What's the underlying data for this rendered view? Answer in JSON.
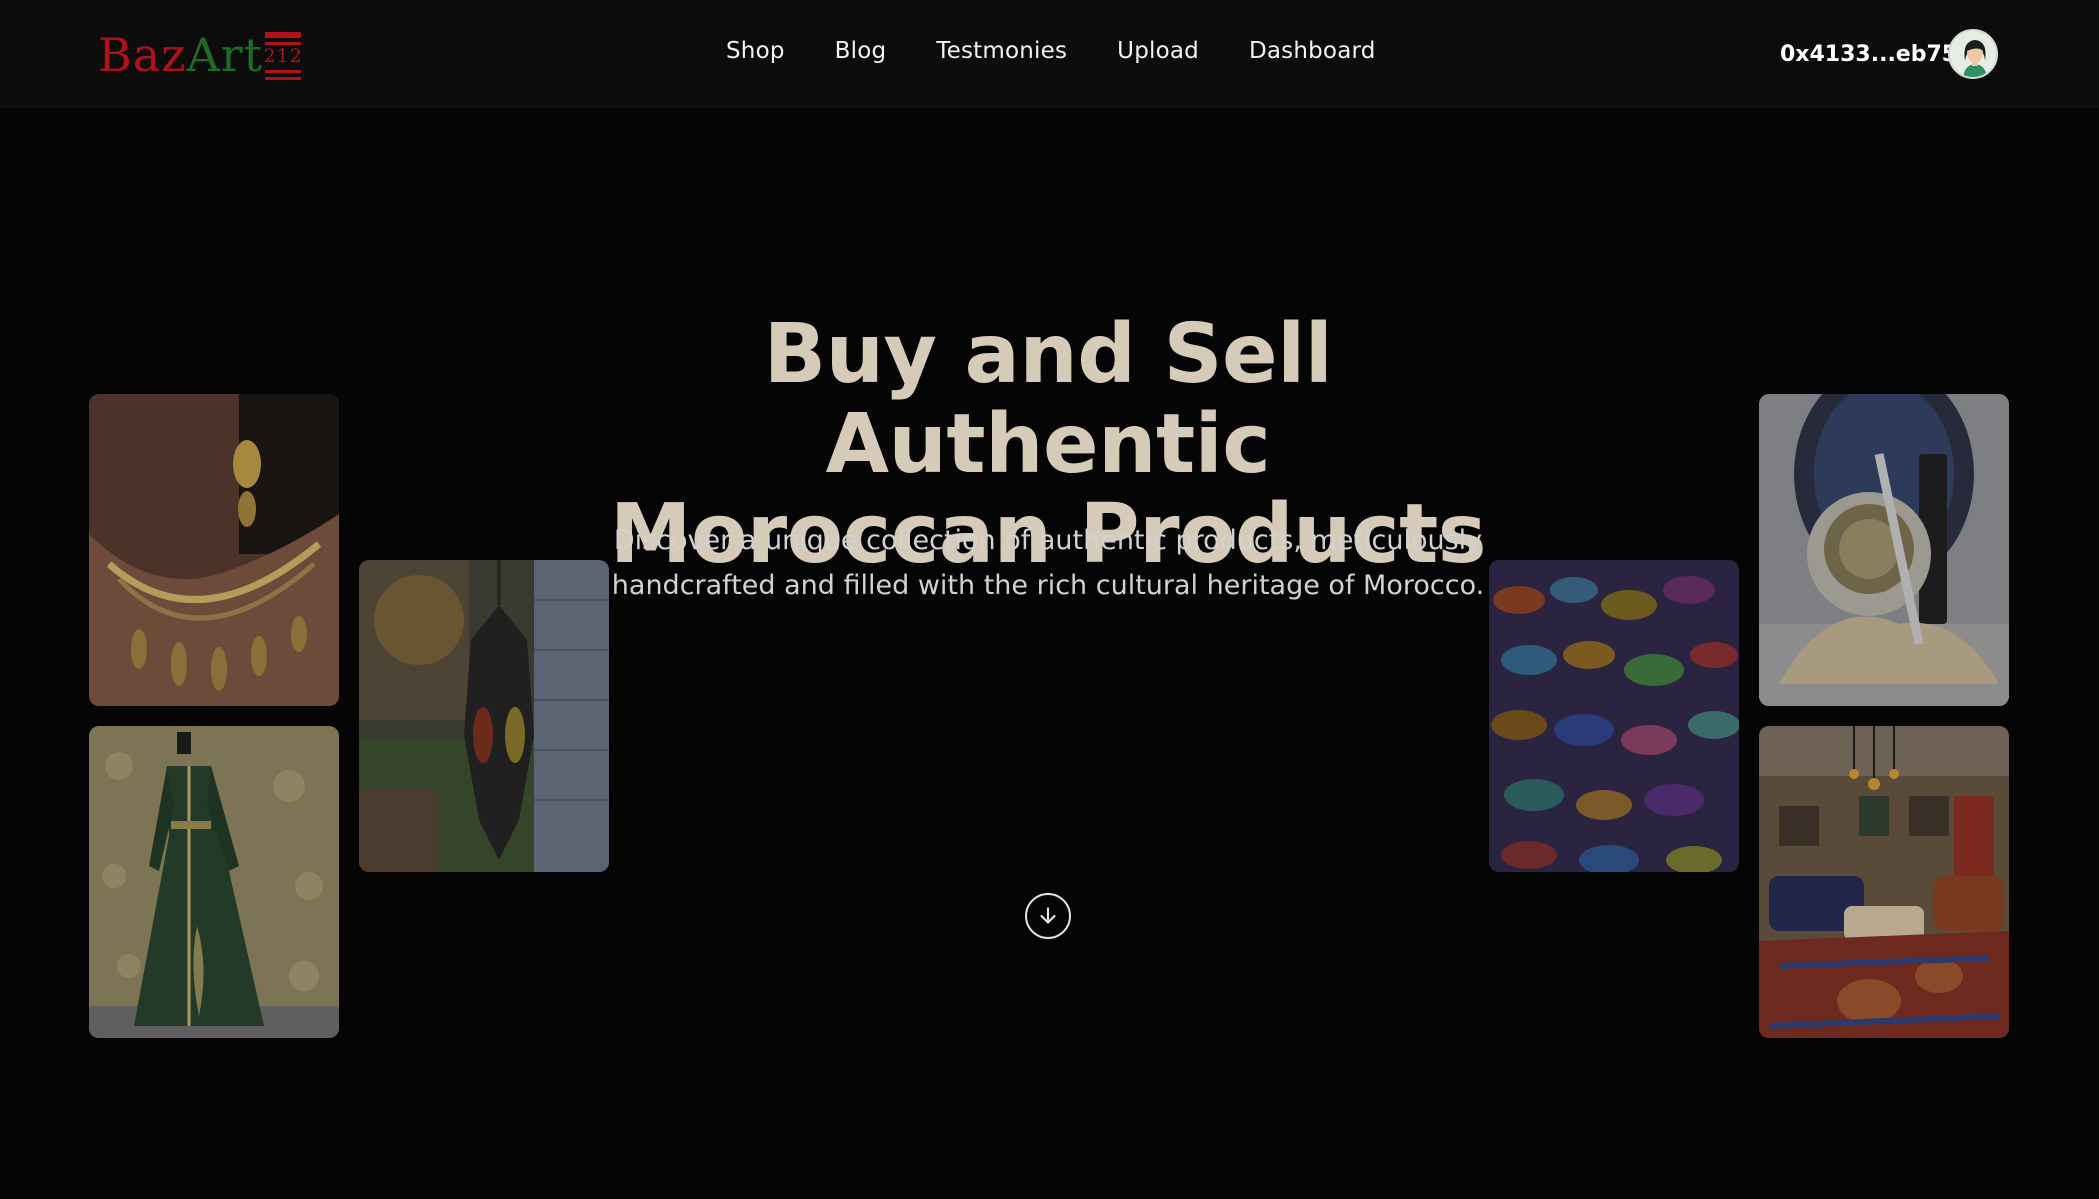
{
  "brand": {
    "logo_part1": "Baz",
    "logo_part2": "Art",
    "logo_badge": "212"
  },
  "nav": {
    "links": [
      {
        "label": "Shop"
      },
      {
        "label": "Blog"
      },
      {
        "label": "Testmonies"
      },
      {
        "label": "Upload"
      },
      {
        "label": "Dashboard"
      }
    ],
    "wallet_address": "0x4133...eb75",
    "avatar_icon": "user-avatar-icon"
  },
  "hero": {
    "title": "Buy and Sell Authentic\nMoroccan Products",
    "subtitle": "Discover a unique collection of authentic products, meticulously handcrafted and filled with the rich cultural heritage of Morocco.",
    "scroll_icon": "arrow-down-circle-icon"
  },
  "gallery": [
    {
      "subject": "gold jewelry necklace and earring"
    },
    {
      "subject": "green embroidered kaftan dress"
    },
    {
      "subject": "hanging moroccan lantern"
    },
    {
      "subject": "colorful ceramic bowls market"
    },
    {
      "subject": "cosmetic jar with clay powder"
    },
    {
      "subject": "moroccan living room interior"
    }
  ],
  "colors": {
    "background": "#050505",
    "navbar": "#0c0c0c",
    "title": "#d6cbb8",
    "logo_red": "#b0121a",
    "logo_green": "#1d6b25"
  }
}
